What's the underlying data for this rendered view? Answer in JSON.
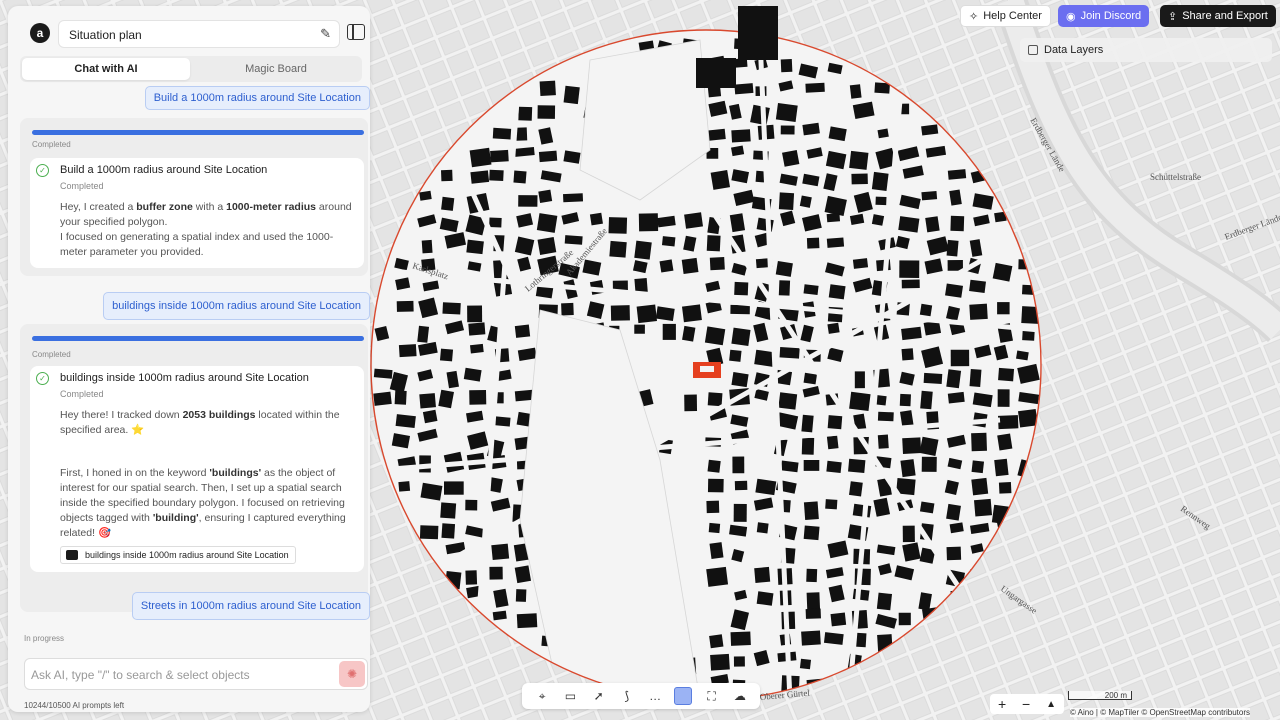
{
  "header": {
    "title": "Situation plan",
    "tabs": [
      "Chat with AI",
      "Magic Board"
    ]
  },
  "chat": {
    "messages": [
      {
        "role": "user",
        "text": "Build a 1000m radius around Site Location"
      },
      {
        "role": "ai",
        "status": "Completed",
        "task_title": "Build a 1000m radius around Site Location",
        "task_status": "Completed",
        "paragraphs": [
          [
            "Hey, I created a ",
            "buffer zone",
            " with a ",
            "1000-meter radius",
            " around your specified polygon."
          ],
          [
            "I focused on generating a spatial index and used the 1000-meter parameter you provided."
          ]
        ]
      },
      {
        "role": "user",
        "text": "buildings inside 1000m radius around Site Location"
      },
      {
        "role": "ai",
        "status": "Completed",
        "task_title": "buildings inside 1000m radius around Site Location",
        "task_status": "Completed",
        "paragraphs": [
          [
            "Hey there! I tracked down ",
            "2053 buildings",
            " located within the specified area. ⭐"
          ],
          [
            "First, I honed in on the keyword ",
            "'buildings'",
            " as the object of interest for our spatial search. Then, I set up a spatial search inside the specified boundary polygon. I focused on retrieving objects tagged with ",
            "'building'",
            ", ensuring I captured everything related! 🎯"
          ]
        ],
        "chip": "buildings inside 1000m radius around Site Location"
      },
      {
        "role": "user",
        "text": "Streets in 1000m radius around Site Location"
      }
    ],
    "pending_status": "In progress",
    "input_placeholder": "Ask AI, type \"/\" to search & select objects",
    "quota": "10244/10500 AI prompts left"
  },
  "topbar_right": {
    "help": "Help Center",
    "discord": "Join Discord",
    "share": "Share and Export"
  },
  "layers_label": "Data Layers",
  "map": {
    "labels": [
      "Karlsplatz",
      "Lothringerstraße",
      "Akademiestraße",
      "Erdberger Lände",
      "Schüttelstraße",
      "Erdberger Lände",
      "Rennweg",
      "Ungargasse",
      "Oberer Gürtel"
    ],
    "scale": "200 m",
    "attribution": "© Aino | © MapTiler © OpenStreetMap contributors",
    "accent_site": "#e5401f",
    "circle_color": "#d9492e"
  },
  "toolbar": {
    "tools": [
      "pin-icon",
      "rect-select-icon",
      "cursor-icon",
      "route-icon",
      "chat-bubble-icon",
      "square-icon",
      "scan-icon",
      "cloud-icon"
    ],
    "active_index": 5
  },
  "zoom": {
    "in": "+",
    "out": "−",
    "north": "▲"
  }
}
